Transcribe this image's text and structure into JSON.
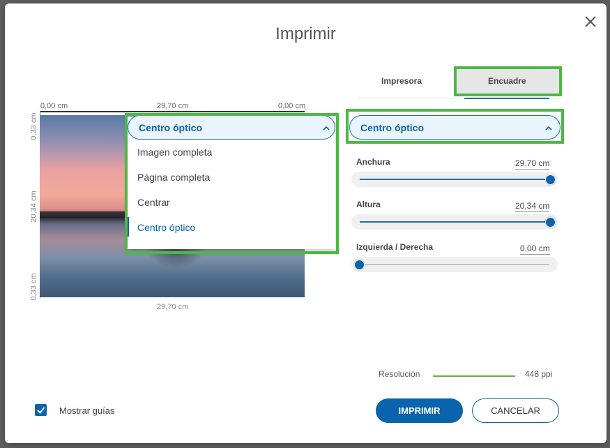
{
  "dialog": {
    "title": "Imprimir",
    "close_icon": "close-icon"
  },
  "ruler": {
    "top_left": "0,00 cm",
    "top_center": "29,70 cm",
    "top_right": "0,00 cm",
    "left_top": "0,33 cm",
    "left_middle": "20,34 cm",
    "left_bottom": "0,33 cm",
    "bottom_center": "29,70 cm"
  },
  "crop_dropdown": {
    "selected": "Centro óptico",
    "options": [
      "Imagen completa",
      "Página completa",
      "Centrar",
      "Centro óptico"
    ]
  },
  "tabs": [
    {
      "label": "Impresora",
      "active": false
    },
    {
      "label": "Encuadre",
      "active": true
    }
  ],
  "mode_dropdown": {
    "selected": "Centro óptico"
  },
  "sliders": [
    {
      "label": "Anchura",
      "value": "29,70 cm",
      "level": 1.0
    },
    {
      "label": "Altura",
      "value": "20,34 cm",
      "level": 1.0
    },
    {
      "label": "Izquierda / Derecha",
      "value": "0,00 cm",
      "level": 0.0
    }
  ],
  "resolution": {
    "label": "Resolución",
    "value": "448 ppi"
  },
  "footer": {
    "show_guides_label": "Mostrar guías",
    "show_guides_checked": true,
    "print_button": "IMPRIMIR",
    "cancel_button": "CANCELAR"
  },
  "colors": {
    "accent": "#0a64ad",
    "highlight": "#4cb944",
    "resolution_bar": "#62b246"
  }
}
